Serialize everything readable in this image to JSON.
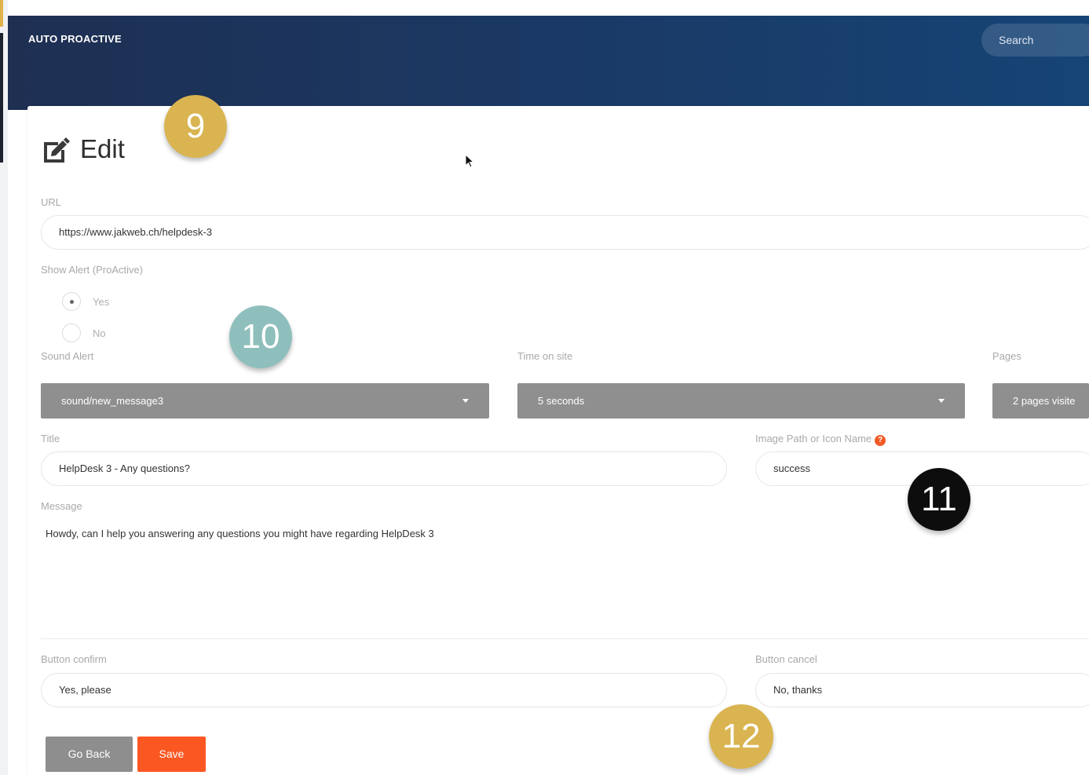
{
  "header": {
    "brand": "AUTO PROACTIVE",
    "search_placeholder": "Search"
  },
  "page": {
    "title": "Edit",
    "title_icon": "edit-icon"
  },
  "form": {
    "url": {
      "label": "URL",
      "value": "https://www.jakweb.ch/helpdesk-3"
    },
    "show_alert": {
      "label": "Show Alert (ProActive)",
      "options": [
        "Yes",
        "No"
      ],
      "selected": "Yes"
    },
    "sound_alert": {
      "label": "Sound Alert",
      "value": "sound/new_message3"
    },
    "time_on_site": {
      "label": "Time on site",
      "value": "5 seconds"
    },
    "pages": {
      "label": "Pages",
      "value": "2 pages visite"
    },
    "title": {
      "label": "Title",
      "value": "HelpDesk 3 - Any questions?"
    },
    "image_path": {
      "label": "Image Path or Icon Name",
      "help_icon": "question-icon",
      "value": "success"
    },
    "message": {
      "label": "Message",
      "value": "Howdy, can I help you answering any questions you might have regarding HelpDesk 3"
    },
    "button_confirm": {
      "label": "Button confirm",
      "value": "Yes, please"
    },
    "button_cancel": {
      "label": "Button cancel",
      "value": "No, thanks"
    }
  },
  "actions": {
    "go_back": "Go Back",
    "save": "Save"
  },
  "annotations": [
    {
      "number": "9",
      "color": "#d9b451",
      "text_color": "#ffffff"
    },
    {
      "number": "10",
      "color": "#8fbfbc",
      "text_color": "#ffffff"
    },
    {
      "number": "11",
      "color": "#0d0d0d",
      "text_color": "#ffffff"
    },
    {
      "number": "12",
      "color": "#d9b451",
      "text_color": "#ffffff"
    }
  ],
  "colors": {
    "header_from": "#1e2f52",
    "header_to": "#154476",
    "save": "#fb5722",
    "select_bg": "#8f8f8f",
    "help": "#f05a28"
  }
}
